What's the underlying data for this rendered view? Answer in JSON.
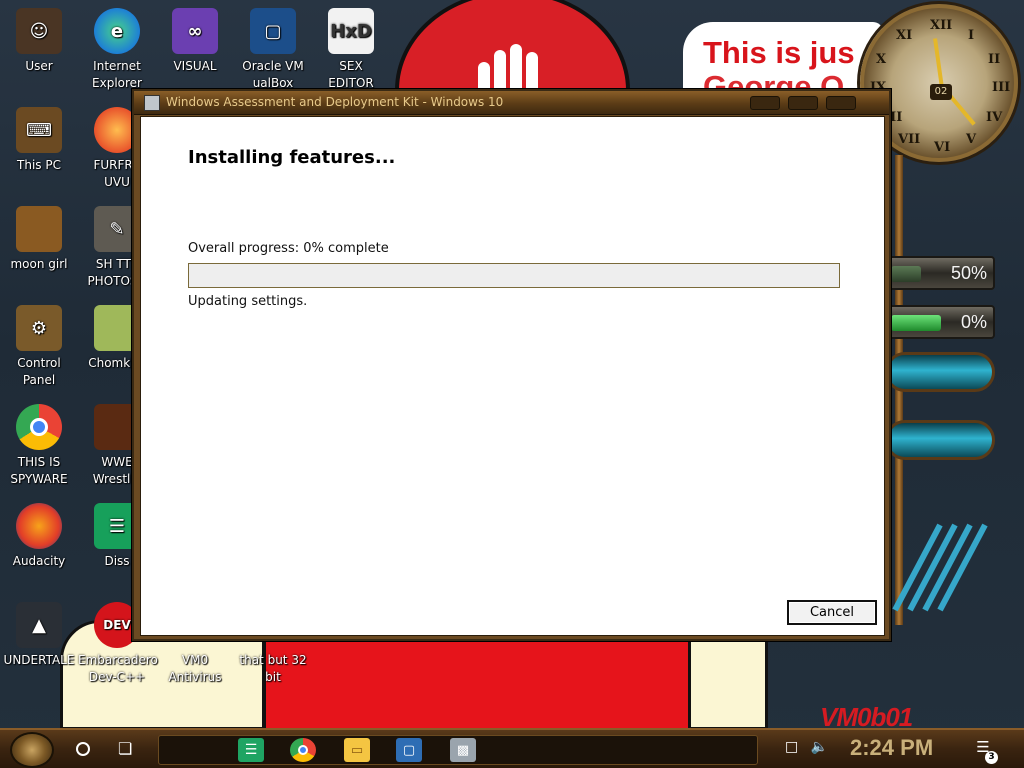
{
  "dialog": {
    "title": "Windows Assessment and Deployment Kit - Windows 10",
    "heading": "Installing features...",
    "progress_label": "Overall progress: 0% complete",
    "progress_percent": 0,
    "status": "Updating settings.",
    "cancel_label": "Cancel"
  },
  "desktop_icons": [
    {
      "label": "User",
      "icon": "user-icon"
    },
    {
      "label": "Internet\nExplorer",
      "icon": "edge-icon"
    },
    {
      "label": "VISUAL",
      "icon": "visual-studio-icon"
    },
    {
      "label": "Oracle VM\nualBox",
      "icon": "virtualbox-icon"
    },
    {
      "label": "SEX\nEDITOR",
      "icon": "hex-editor-icon"
    },
    {
      "label": "This PC",
      "icon": "computer-icon"
    },
    {
      "label": "FURFRC\nUVU",
      "icon": "firefox-icon"
    },
    {
      "label": "moon girl",
      "icon": "folder-icon"
    },
    {
      "label": "SH TTY\nPHOTOSH",
      "icon": "gimp-icon"
    },
    {
      "label": "Control Panel",
      "icon": "control-panel-icon"
    },
    {
      "label": "ChomkBo",
      "icon": "hamster-icon"
    },
    {
      "label": "THIS IS\nSPYWARE",
      "icon": "chrome-icon"
    },
    {
      "label": "WWE\nWrestlin",
      "icon": "game-icon"
    },
    {
      "label": "Audacity",
      "icon": "audacity-icon"
    },
    {
      "label": "Diss",
      "icon": "spreadsheet-icon"
    },
    {
      "label": "UNDERTALE",
      "icon": "unity-icon"
    },
    {
      "label": "Embarcadero\nDev-C++",
      "icon": "devcpp-icon"
    },
    {
      "label": "VM0\nAntivirus",
      "icon": "antivirus-icon"
    },
    {
      "label": "that but 32\nbit",
      "icon": "app-icon"
    }
  ],
  "widgets": {
    "note_line1": "This is jus",
    "note_line2": "George O",
    "clock_numerals": [
      "XII",
      "I",
      "II",
      "III",
      "IV",
      "V",
      "VI",
      "VII",
      "VIII",
      "IX",
      "X",
      "XI"
    ],
    "clock_date": "02",
    "gauge1_text": "50%",
    "gauge1_value": 50,
    "gauge2_text": "0%",
    "gauge2_value": 0,
    "vm_text": "VM0b01"
  },
  "taskbar": {
    "apps": [
      {
        "name": "taskbar-app-sheets",
        "icon": "sheets-icon",
        "color": "#1fa463"
      },
      {
        "name": "taskbar-app-chrome",
        "icon": "chrome-icon",
        "color": "#ea4335"
      },
      {
        "name": "taskbar-app-explorer",
        "icon": "folder-icon",
        "color": "#f4c542"
      },
      {
        "name": "taskbar-app-virtualbox",
        "icon": "virtualbox-icon",
        "color": "#2e6db4"
      },
      {
        "name": "taskbar-app-installer",
        "icon": "installer-icon",
        "color": "#9aa4ad"
      }
    ],
    "time": "2:24 PM",
    "notification_count": "3"
  },
  "colors": {
    "titlebar": "#5b3c16",
    "title_text": "#e7c98a",
    "clock_text": "#c9b07a",
    "wallpaper_red": "#e6141b"
  }
}
